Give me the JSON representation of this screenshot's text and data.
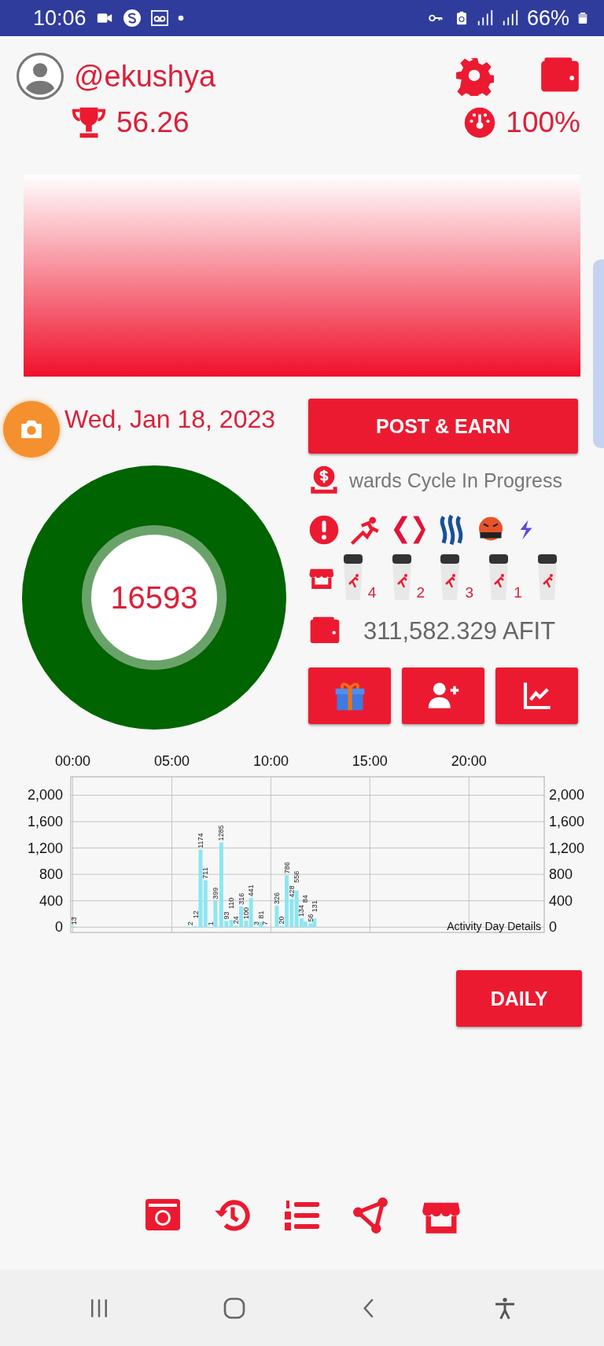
{
  "status_bar": {
    "time": "10:06",
    "battery": "66%"
  },
  "profile": {
    "username": "@ekushya",
    "score": "56.26",
    "power": "100%"
  },
  "date": "Wed, Jan 18, 2023",
  "steps": "16593",
  "post_button": "POST & EARN",
  "rewards_status": "wards Cycle In Progress",
  "products": [
    {
      "kind": "shaker",
      "count": "4"
    },
    {
      "kind": "shaker",
      "count": "2"
    },
    {
      "kind": "shaker",
      "count": "3"
    },
    {
      "kind": "shaker",
      "count": "1"
    },
    {
      "kind": "shaker"
    }
  ],
  "balance": "311,582.329 AFIT",
  "chart": {
    "caption": "Activity Day Details",
    "chart_data": {
      "type": "bar",
      "x": [
        0.05,
        5.95,
        6.2,
        6.45,
        6.7,
        6.95,
        7.2,
        7.5,
        7.75,
        8.0,
        8.25,
        8.5,
        8.75,
        9.0,
        9.25,
        9.5,
        9.7,
        10.3,
        10.55,
        10.8,
        11.05,
        11.3,
        11.55,
        11.75,
        12.0,
        12.2
      ],
      "values": [
        13,
        2,
        12,
        1174,
        711,
        1,
        399,
        1285,
        93,
        110,
        24,
        316,
        100,
        441,
        3,
        81,
        7,
        326,
        20,
        786,
        428,
        556,
        134,
        84,
        56,
        131
      ],
      "value_labels": [
        "13",
        "2",
        "12",
        "1174",
        "711",
        "1",
        "399",
        "1285",
        "93",
        "110",
        "24",
        "316",
        "100",
        "441",
        "3",
        "81",
        "7",
        "326",
        "20",
        "786",
        "428",
        "556",
        "134",
        "84",
        "56",
        "131"
      ],
      "xlim": [
        -0.1,
        23.8
      ],
      "ylim": [
        -80,
        2280
      ],
      "xticks": [
        {
          "value": 0,
          "label": "00:00"
        },
        {
          "value": 5,
          "label": "05:00"
        },
        {
          "value": 10,
          "label": "10:00"
        },
        {
          "value": 15,
          "label": "15:00"
        },
        {
          "value": 20,
          "label": "20:00"
        }
      ],
      "yticks": [
        {
          "value": 0,
          "label": "0"
        },
        {
          "value": 400,
          "label": "400"
        },
        {
          "value": 800,
          "label": "800"
        },
        {
          "value": 1200,
          "label": "1,200"
        },
        {
          "value": 1600,
          "label": "1,600"
        },
        {
          "value": 2000,
          "label": "2,000"
        }
      ],
      "grid": true
    }
  },
  "daily_button": "DAILY"
}
